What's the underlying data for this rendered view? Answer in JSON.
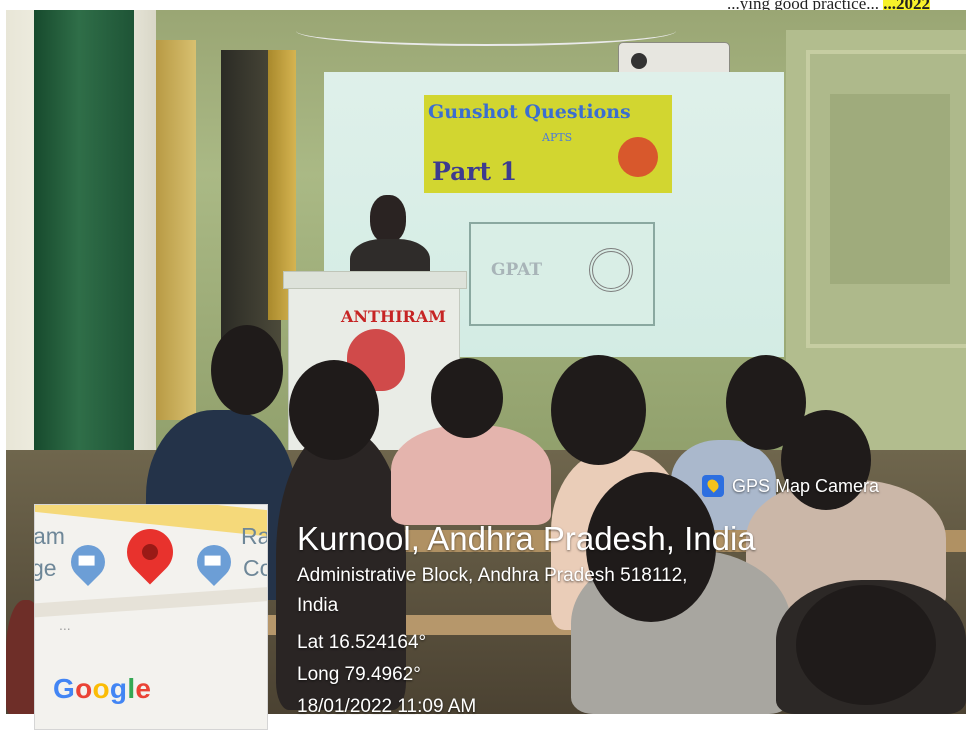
{
  "caption": {
    "text": "...ying good practice...",
    "highlight": "...2022"
  },
  "slide": {
    "title_line1": "Gunshot Questions",
    "title_line2": "Part 1",
    "title_small": "APTS",
    "box_text": "GPAT"
  },
  "podium": {
    "crest_text": "ANTHIRAM"
  },
  "map": {
    "labels": [
      "am",
      "ge",
      "Ra",
      "Co"
    ],
    "ellipsis": "...",
    "brand": "Google",
    "brand_colors": [
      "#4285f4",
      "#ea4335",
      "#fbbc05",
      "#4285f4",
      "#34a853",
      "#ea4335"
    ]
  },
  "gps": {
    "app_name": "GPS Map Camera",
    "icon": "map-pin-icon"
  },
  "location": {
    "title": "Kurnool, Andhra Pradesh, India",
    "address_line1": "Administrative Block, Andhra Pradesh 518112,",
    "address_line2": "India",
    "latitude": "Lat 16.524164°",
    "longitude": "Long 79.4962°",
    "timestamp": "18/01/2022 11:09 AM"
  }
}
